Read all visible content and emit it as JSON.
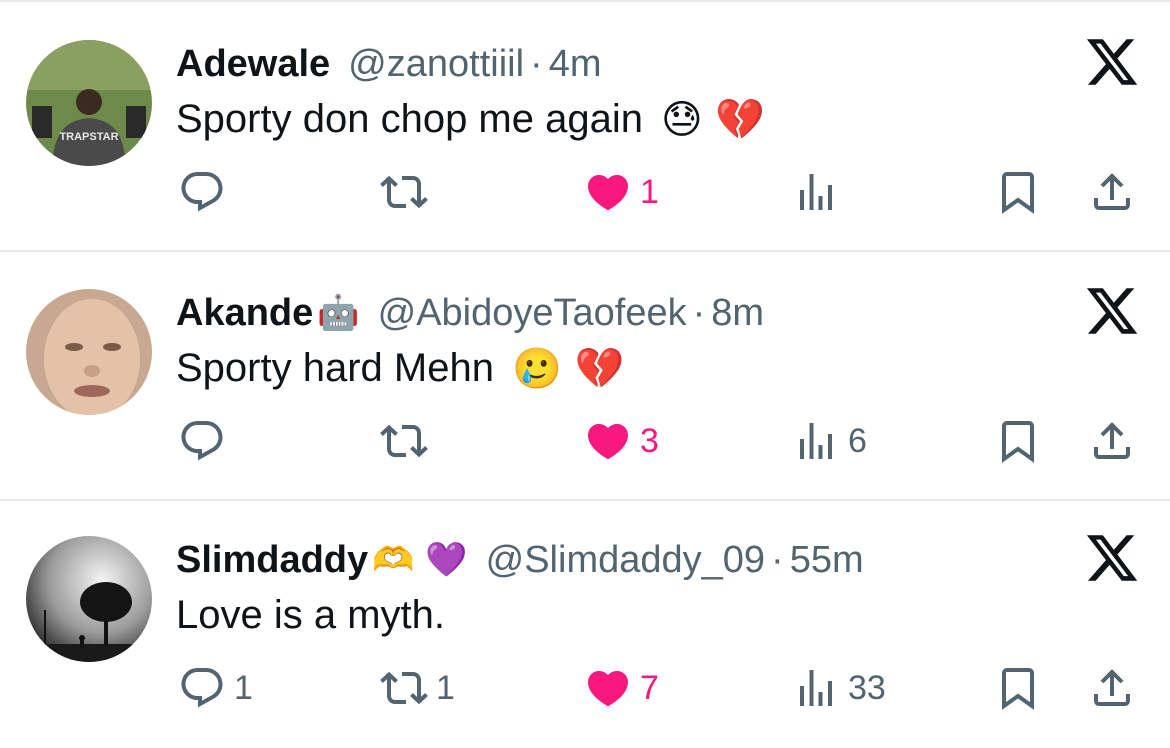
{
  "colors": {
    "text": "#0f1419",
    "secondary": "#536471",
    "like": "#f91880",
    "divider": "#e7e9ea"
  },
  "tweets": [
    {
      "name": "Adewale",
      "name_emoji": "",
      "handle": "@zanottiiil",
      "separator": "·",
      "time": "4m",
      "text": "Sporty don chop me again",
      "text_emoji": "😓 💔",
      "avatar_text": "TRAPSTAR",
      "replies": "",
      "retweets": "",
      "likes": "1",
      "liked": true,
      "views": ""
    },
    {
      "name": "Akande",
      "name_emoji": "🤖",
      "handle": "@AbidoyeTaofeek",
      "separator": "·",
      "time": "8m",
      "text": "Sporty hard Mehn",
      "text_emoji": "🥲 💔",
      "avatar_text": "",
      "replies": "",
      "retweets": "",
      "likes": "3",
      "liked": true,
      "views": "6"
    },
    {
      "name": "Slimdaddy",
      "name_emoji": "🫶 💜",
      "handle": "@Slimdaddy_09",
      "separator": "·",
      "time": "55m",
      "text": "Love is a myth.",
      "text_emoji": "",
      "avatar_text": "",
      "replies": "1",
      "retweets": "1",
      "likes": "7",
      "liked": true,
      "views": "33"
    }
  ],
  "icons": {
    "reply": "reply-icon",
    "retweet": "retweet-icon",
    "like": "heart-icon",
    "views": "views-icon",
    "bookmark": "bookmark-icon",
    "share": "share-icon",
    "close": "x-logo-icon"
  }
}
